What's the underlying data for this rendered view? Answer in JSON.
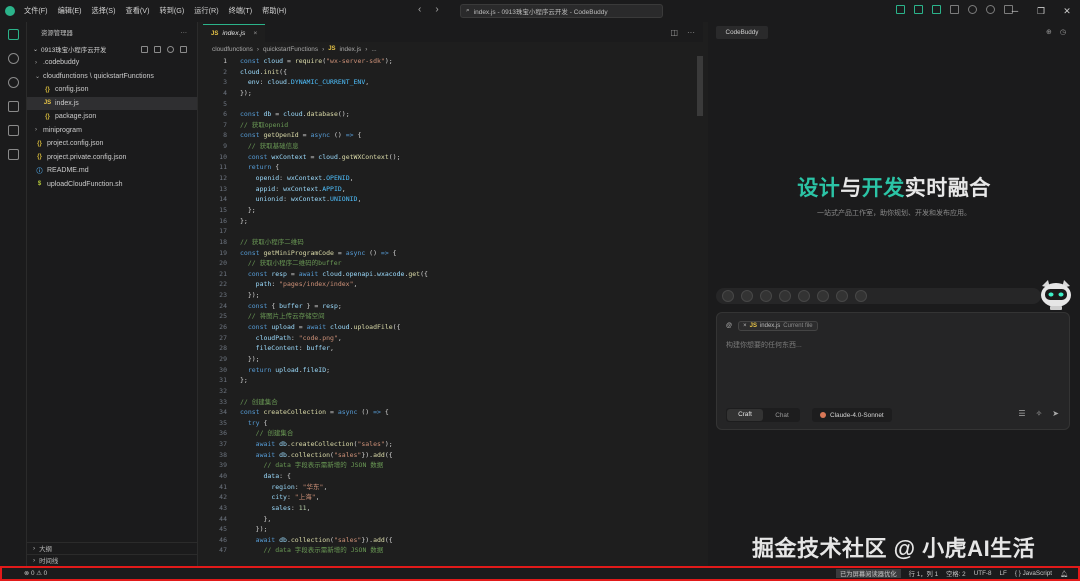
{
  "titlebar": {
    "menu": [
      "文件(F)",
      "编辑(E)",
      "选择(S)",
      "查看(V)",
      "转到(G)",
      "运行(R)",
      "终端(T)",
      "帮助(H)"
    ],
    "search_text": "index.js - 0913珠宝小程序云开发 - CodeBuddy",
    "accent": "#2bb38a"
  },
  "sidebar": {
    "header": "资源管理器",
    "project": "0913珠宝小程序云开发",
    "tree": [
      {
        "label": ".codebuddy",
        "type": "folder",
        "depth": 1
      },
      {
        "label": "cloudfunctions \\ quickstartFunctions",
        "type": "folder-open",
        "depth": 1
      },
      {
        "label": "config.json",
        "type": "json",
        "depth": 2
      },
      {
        "label": "index.js",
        "type": "js",
        "depth": 2,
        "selected": true
      },
      {
        "label": "package.json",
        "type": "json",
        "depth": 2
      },
      {
        "label": "miniprogram",
        "type": "folder",
        "depth": 1
      },
      {
        "label": "project.config.json",
        "type": "json",
        "depth": 1
      },
      {
        "label": "project.private.config.json",
        "type": "json",
        "depth": 1
      },
      {
        "label": "README.md",
        "type": "info",
        "depth": 1
      },
      {
        "label": "uploadCloudFunction.sh",
        "type": "sh",
        "depth": 1
      }
    ],
    "bottom_sections": [
      "大纲",
      "时间线"
    ]
  },
  "editor": {
    "tab_label": "index.js",
    "breadcrumb": [
      "cloudfunctions",
      "quickstartFunctions",
      "index.js",
      "..."
    ],
    "current_line": 1,
    "lines": [
      [
        [
          "k",
          "const "
        ],
        [
          "v",
          "cloud"
        ],
        [
          "p",
          " = "
        ],
        [
          "f",
          "require"
        ],
        [
          "p",
          "("
        ],
        [
          "s",
          "\"wx-server-sdk\""
        ],
        [
          "p",
          ");"
        ]
      ],
      [
        [
          "v",
          "cloud"
        ],
        [
          "p",
          "."
        ],
        [
          "f",
          "init"
        ],
        [
          "p",
          "({"
        ]
      ],
      [
        [
          "p",
          "  "
        ],
        [
          "v",
          "env"
        ],
        [
          "p",
          ": "
        ],
        [
          "v",
          "cloud"
        ],
        [
          "p",
          "."
        ],
        [
          "cn",
          "DYNAMIC_CURRENT_ENV"
        ],
        [
          "p",
          ","
        ]
      ],
      [
        [
          "p",
          "});"
        ]
      ],
      [],
      [
        [
          "k",
          "const "
        ],
        [
          "v",
          "db"
        ],
        [
          "p",
          " = "
        ],
        [
          "v",
          "cloud"
        ],
        [
          "p",
          "."
        ],
        [
          "f",
          "database"
        ],
        [
          "p",
          "();"
        ]
      ],
      [
        [
          "c",
          "// 获取openid"
        ]
      ],
      [
        [
          "k",
          "const "
        ],
        [
          "f",
          "getOpenId"
        ],
        [
          "p",
          " = "
        ],
        [
          "k",
          "async "
        ],
        [
          "p",
          "() "
        ],
        [
          "k",
          "=>"
        ],
        [
          "p",
          " {"
        ]
      ],
      [
        [
          "p",
          "  "
        ],
        [
          "c",
          "// 获取基础信息"
        ]
      ],
      [
        [
          "p",
          "  "
        ],
        [
          "k",
          "const "
        ],
        [
          "v",
          "wxContext"
        ],
        [
          "p",
          " = "
        ],
        [
          "v",
          "cloud"
        ],
        [
          "p",
          "."
        ],
        [
          "f",
          "getWXContext"
        ],
        [
          "p",
          "();"
        ]
      ],
      [
        [
          "p",
          "  "
        ],
        [
          "k",
          "return"
        ],
        [
          "p",
          " {"
        ]
      ],
      [
        [
          "p",
          "    "
        ],
        [
          "v",
          "openid"
        ],
        [
          "p",
          ": "
        ],
        [
          "v",
          "wxContext"
        ],
        [
          "p",
          "."
        ],
        [
          "cn",
          "OPENID"
        ],
        [
          "p",
          ","
        ]
      ],
      [
        [
          "p",
          "    "
        ],
        [
          "v",
          "appid"
        ],
        [
          "p",
          ": "
        ],
        [
          "v",
          "wxContext"
        ],
        [
          "p",
          "."
        ],
        [
          "cn",
          "APPID"
        ],
        [
          "p",
          ","
        ]
      ],
      [
        [
          "p",
          "    "
        ],
        [
          "v",
          "unionid"
        ],
        [
          "p",
          ": "
        ],
        [
          "v",
          "wxContext"
        ],
        [
          "p",
          "."
        ],
        [
          "cn",
          "UNIONID"
        ],
        [
          "p",
          ","
        ]
      ],
      [
        [
          "p",
          "  };"
        ]
      ],
      [
        [
          "p",
          "};"
        ]
      ],
      [],
      [
        [
          "c",
          "// 获取小程序二维码"
        ]
      ],
      [
        [
          "k",
          "const "
        ],
        [
          "f",
          "getMiniProgramCode"
        ],
        [
          "p",
          " = "
        ],
        [
          "k",
          "async "
        ],
        [
          "p",
          "() "
        ],
        [
          "k",
          "=>"
        ],
        [
          "p",
          " {"
        ]
      ],
      [
        [
          "p",
          "  "
        ],
        [
          "c",
          "// 获取小程序二维码的buffer"
        ]
      ],
      [
        [
          "p",
          "  "
        ],
        [
          "k",
          "const "
        ],
        [
          "v",
          "resp"
        ],
        [
          "p",
          " = "
        ],
        [
          "k",
          "await "
        ],
        [
          "v",
          "cloud"
        ],
        [
          "p",
          "."
        ],
        [
          "v",
          "openapi"
        ],
        [
          "p",
          "."
        ],
        [
          "v",
          "wxacode"
        ],
        [
          "p",
          "."
        ],
        [
          "f",
          "get"
        ],
        [
          "p",
          "({"
        ]
      ],
      [
        [
          "p",
          "    "
        ],
        [
          "v",
          "path"
        ],
        [
          "p",
          ": "
        ],
        [
          "s",
          "\"pages/index/index\""
        ],
        [
          "p",
          ","
        ]
      ],
      [
        [
          "p",
          "  });"
        ]
      ],
      [
        [
          "p",
          "  "
        ],
        [
          "k",
          "const "
        ],
        [
          "p",
          "{ "
        ],
        [
          "v",
          "buffer"
        ],
        [
          "p",
          " } = "
        ],
        [
          "v",
          "resp"
        ],
        [
          "p",
          ";"
        ]
      ],
      [
        [
          "p",
          "  "
        ],
        [
          "c",
          "// 将图片上传云存储空间"
        ]
      ],
      [
        [
          "p",
          "  "
        ],
        [
          "k",
          "const "
        ],
        [
          "v",
          "upload"
        ],
        [
          "p",
          " = "
        ],
        [
          "k",
          "await "
        ],
        [
          "v",
          "cloud"
        ],
        [
          "p",
          "."
        ],
        [
          "f",
          "uploadFile"
        ],
        [
          "p",
          "({"
        ]
      ],
      [
        [
          "p",
          "    "
        ],
        [
          "v",
          "cloudPath"
        ],
        [
          "p",
          ": "
        ],
        [
          "s",
          "\"code.png\""
        ],
        [
          "p",
          ","
        ]
      ],
      [
        [
          "p",
          "    "
        ],
        [
          "v",
          "fileContent"
        ],
        [
          "p",
          ": "
        ],
        [
          "v",
          "buffer"
        ],
        [
          "p",
          ","
        ]
      ],
      [
        [
          "p",
          "  });"
        ]
      ],
      [
        [
          "p",
          "  "
        ],
        [
          "k",
          "return "
        ],
        [
          "v",
          "upload"
        ],
        [
          "p",
          "."
        ],
        [
          "v",
          "fileID"
        ],
        [
          "p",
          ";"
        ]
      ],
      [
        [
          "p",
          "};"
        ]
      ],
      [],
      [
        [
          "c",
          "// 创建集合"
        ]
      ],
      [
        [
          "k",
          "const "
        ],
        [
          "f",
          "createCollection"
        ],
        [
          "p",
          " = "
        ],
        [
          "k",
          "async "
        ],
        [
          "p",
          "() "
        ],
        [
          "k",
          "=>"
        ],
        [
          "p",
          " {"
        ]
      ],
      [
        [
          "p",
          "  "
        ],
        [
          "k",
          "try"
        ],
        [
          "p",
          " {"
        ]
      ],
      [
        [
          "p",
          "    "
        ],
        [
          "c",
          "// 创建集合"
        ]
      ],
      [
        [
          "p",
          "    "
        ],
        [
          "k",
          "await "
        ],
        [
          "v",
          "db"
        ],
        [
          "p",
          "."
        ],
        [
          "f",
          "createCollection"
        ],
        [
          "p",
          "("
        ],
        [
          "s",
          "\"sales\""
        ],
        [
          "p",
          ");"
        ]
      ],
      [
        [
          "p",
          "    "
        ],
        [
          "k",
          "await "
        ],
        [
          "v",
          "db"
        ],
        [
          "p",
          "."
        ],
        [
          "f",
          "collection"
        ],
        [
          "p",
          "("
        ],
        [
          "s",
          "\"sales\""
        ],
        [
          "p",
          "})."
        ],
        [
          "f",
          "add"
        ],
        [
          "p",
          "({"
        ]
      ],
      [
        [
          "p",
          "      "
        ],
        [
          "c",
          "// data 字段表示需新增的 JSON 数据"
        ]
      ],
      [
        [
          "p",
          "      "
        ],
        [
          "v",
          "data"
        ],
        [
          "p",
          ": {"
        ]
      ],
      [
        [
          "p",
          "        "
        ],
        [
          "v",
          "region"
        ],
        [
          "p",
          ": "
        ],
        [
          "s",
          "\"华东\""
        ],
        [
          "p",
          ","
        ]
      ],
      [
        [
          "p",
          "        "
        ],
        [
          "v",
          "city"
        ],
        [
          "p",
          ": "
        ],
        [
          "s",
          "\"上海\""
        ],
        [
          "p",
          ","
        ]
      ],
      [
        [
          "p",
          "        "
        ],
        [
          "v",
          "sales"
        ],
        [
          "p",
          ": "
        ],
        [
          "n",
          "11"
        ],
        [
          "p",
          ","
        ]
      ],
      [
        [
          "p",
          "      },"
        ]
      ],
      [
        [
          "p",
          "    });"
        ]
      ],
      [
        [
          "p",
          "    "
        ],
        [
          "k",
          "await "
        ],
        [
          "v",
          "db"
        ],
        [
          "p",
          "."
        ],
        [
          "f",
          "collection"
        ],
        [
          "p",
          "("
        ],
        [
          "s",
          "\"sales\""
        ],
        [
          "p",
          "})."
        ],
        [
          "f",
          "add"
        ],
        [
          "p",
          "({"
        ]
      ],
      [
        [
          "p",
          "      "
        ],
        [
          "c",
          "// data 字段表示需新增的 JSON 数据"
        ]
      ]
    ]
  },
  "panel": {
    "tab_label": "CodeBuddy",
    "hero": [
      {
        "text": "设计",
        "style": "g"
      },
      {
        "text": "与",
        "style": "w"
      },
      {
        "text": "开发",
        "style": "g"
      },
      {
        "text": "实时融合",
        "style": "w"
      }
    ],
    "subtitle": "一站式产品工作室，助你规划、开发和发布应用。",
    "context_file": "index.js",
    "context_label": "Current file",
    "input_placeholder": "构建你想要的任何东西...",
    "modes": [
      "Craft",
      "Chat"
    ],
    "active_mode": "Craft",
    "model": "Claude-4.0-Sonnet"
  },
  "watermark": "掘金技术社区 @ 小虎AI生活",
  "statusbar": {
    "problems": "⊗ 0 ⚠ 0",
    "screen_reader": "已为屏幕阅读器优化",
    "position": "行 1，列 1",
    "spaces": "空格: 2",
    "encoding": "UTF-8",
    "eol": "LF",
    "language": "{ } JavaScript",
    "highlight_color": "#e21a1a"
  }
}
